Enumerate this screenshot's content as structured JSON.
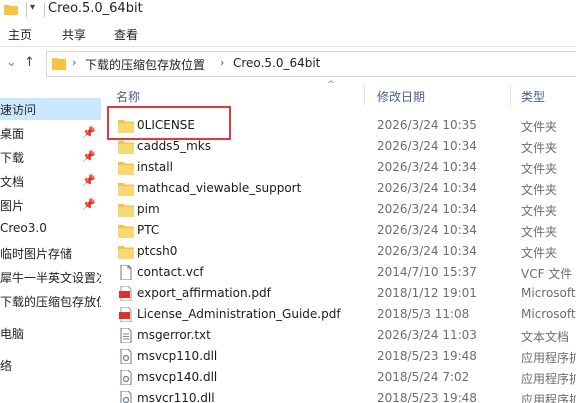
{
  "window": {
    "title": "Creo.5.0_64bit"
  },
  "ribbon": {
    "tabs": [
      {
        "label": "主页"
      },
      {
        "label": "共享"
      },
      {
        "label": "查看"
      }
    ]
  },
  "address": {
    "crumbs": [
      "下载的压缩包存放位置",
      "Creo.5.0_64bit"
    ]
  },
  "sidebar": {
    "items": [
      {
        "label": "速访问",
        "selected": true,
        "pinned": false
      },
      {
        "label": "桌面",
        "selected": false,
        "pinned": true
      },
      {
        "label": "下载",
        "selected": false,
        "pinned": true
      },
      {
        "label": "文档",
        "selected": false,
        "pinned": true
      },
      {
        "label": "图片",
        "selected": false,
        "pinned": true
      },
      {
        "label": "Creo3.0",
        "selected": false,
        "pinned": false
      },
      {
        "label": "临时图片存储",
        "selected": false,
        "pinned": false
      },
      {
        "label": "犀牛一半英文设置次",
        "selected": false,
        "pinned": false
      },
      {
        "label": "下载的压缩包存放位",
        "selected": false,
        "pinned": false
      },
      {
        "label": "电脑",
        "selected": false,
        "pinned": false
      },
      {
        "label": "络",
        "selected": false,
        "pinned": false
      }
    ]
  },
  "columns": {
    "name": "名称",
    "date": "修改日期",
    "type": "类型"
  },
  "files": [
    {
      "name": "0LICENSE",
      "date": "2026/3/24 10:35",
      "type": "文件夹",
      "icon": "folder-icon"
    },
    {
      "name": "cadds5_mks",
      "date": "2026/3/24 10:34",
      "type": "文件夹",
      "icon": "folder-icon"
    },
    {
      "name": "install",
      "date": "2026/3/24 10:34",
      "type": "文件夹",
      "icon": "folder-icon"
    },
    {
      "name": "mathcad_viewable_support",
      "date": "2026/3/24 10:34",
      "type": "文件夹",
      "icon": "folder-icon"
    },
    {
      "name": "pim",
      "date": "2026/3/24 10:34",
      "type": "文件夹",
      "icon": "folder-icon"
    },
    {
      "name": "PTC",
      "date": "2026/3/24 10:34",
      "type": "文件夹",
      "icon": "folder-icon"
    },
    {
      "name": "ptcsh0",
      "date": "2026/3/24 10:34",
      "type": "文件夹",
      "icon": "folder-icon"
    },
    {
      "name": "contact.vcf",
      "date": "2014/7/10 15:37",
      "type": "VCF 文件",
      "icon": "file-icon"
    },
    {
      "name": "export_affirmation.pdf",
      "date": "2018/1/12 19:01",
      "type": "Microsoft",
      "icon": "pdf-icon"
    },
    {
      "name": "License_Administration_Guide.pdf",
      "date": "2018/5/3 11:08",
      "type": "Microsoft",
      "icon": "pdf-icon"
    },
    {
      "name": "msgerror.txt",
      "date": "2026/3/24 11:03",
      "type": "文本文档",
      "icon": "text-file-icon"
    },
    {
      "name": "msvcp110.dll",
      "date": "2018/5/23 19:48",
      "type": "应用程序扩",
      "icon": "dll-icon"
    },
    {
      "name": "msvcp140.dll",
      "date": "2018/5/24 7:02",
      "type": "应用程序扩",
      "icon": "dll-icon"
    },
    {
      "name": "msvcr110.dll",
      "date": "2018/5/23 19:48",
      "type": "应用程序扩",
      "icon": "dll-icon"
    }
  ],
  "colors": {
    "selected": "#cce8ff",
    "folder": "#f5c542",
    "highlight": "#e0383e",
    "header_text": "#4d6082"
  }
}
